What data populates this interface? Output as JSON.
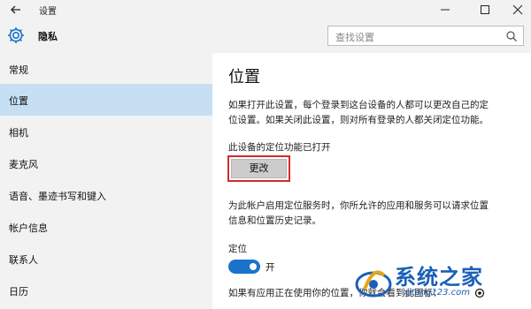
{
  "window": {
    "title": "设置"
  },
  "header": {
    "section_title": "隐私",
    "search_placeholder": "查找设置"
  },
  "sidebar": {
    "items": [
      {
        "label": "常规",
        "active": false
      },
      {
        "label": "位置",
        "active": true
      },
      {
        "label": "相机",
        "active": false
      },
      {
        "label": "麦克风",
        "active": false
      },
      {
        "label": "语音、墨迹书写和键入",
        "active": false
      },
      {
        "label": "帐户信息",
        "active": false
      },
      {
        "label": "联系人",
        "active": false
      },
      {
        "label": "日历",
        "active": false
      }
    ]
  },
  "main": {
    "title": "位置",
    "description_lines": [
      "如果打开此设置，每个登录到这台设备的人都可以更改自己的定",
      "位设置。如果关闭此设置，则对所有登录的人都关闭定位功能。"
    ],
    "device_status": "此设备的定位功能已打开",
    "change_button": "更改",
    "account_lines": [
      "为此帐户启用定位服务时，你所允许的应用和服务可以请求位置",
      "信息和位置历史记录。"
    ],
    "location_label": "定位",
    "toggle_state": "开",
    "bottom_text": "如果有应用正在使用你的位置，你就会看到此图标："
  },
  "watermark": {
    "text": "系统之家",
    "url": "xitong123.com"
  },
  "colors": {
    "accent": "#1a73c9",
    "selection": "#c7dff3",
    "highlight_border": "#d42a2a",
    "chrome": "#f2f2f2"
  },
  "icons": [
    "back-arrow-icon",
    "minimize-icon",
    "maximize-icon",
    "close-icon",
    "gear-icon",
    "search-icon",
    "location-in-use-icon",
    "watermark-logo-icon"
  ]
}
